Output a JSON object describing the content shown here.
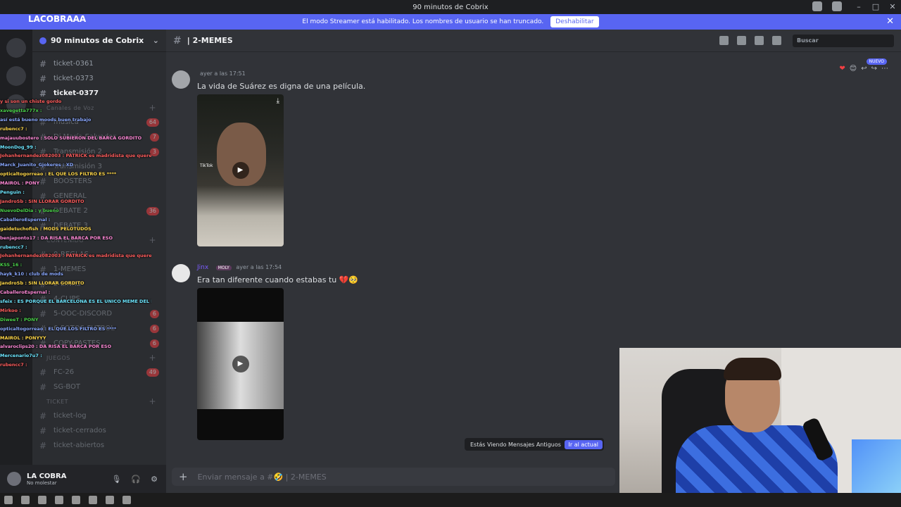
{
  "window": {
    "title": "90 minutos de Cobrix"
  },
  "banner": {
    "text": "El modo Streamer está habilitado. Los nombres de usuario se han truncado.",
    "button": "Deshabilitar"
  },
  "streamer_tag": "LACOBRAAA",
  "guild": {
    "name": "90 minutos de Cobrix"
  },
  "channels": [
    {
      "name": "ticket-0361",
      "bold": false
    },
    {
      "name": "ticket-0373",
      "bold": false
    },
    {
      "name": "ticket-0377",
      "bold": true
    }
  ],
  "sidebar_extra": [
    {
      "type": "cat",
      "label": "Canales de Voz"
    },
    {
      "type": "ch",
      "label": "musica",
      "badge": "64"
    },
    {
      "type": "ch",
      "label": "Di María Salvador",
      "badge": "7"
    },
    {
      "type": "ch",
      "label": "Transmisión 2",
      "badge": "3"
    },
    {
      "type": "ch",
      "label": "Transmisión 3",
      "badge": ""
    },
    {
      "type": "ch",
      "label": "BOOSTERS",
      "badge": ""
    },
    {
      "type": "ch",
      "label": "GENERAL",
      "badge": ""
    },
    {
      "type": "ch",
      "label": "DEBATE 2",
      "badge": "36"
    },
    {
      "type": "ch",
      "label": "DEBATE 3",
      "badge": ""
    },
    {
      "type": "cat",
      "label": "CONTENIDO"
    },
    {
      "type": "ch",
      "label": "0-REGLAS",
      "badge": ""
    },
    {
      "type": "ch",
      "label": "1-MEMES",
      "badge": ""
    },
    {
      "type": "ch",
      "label": "2-LINKS",
      "badge": ""
    },
    {
      "type": "ch",
      "label": "4-CLIPS",
      "badge": ""
    },
    {
      "type": "ch",
      "label": "5-OOC-DISCORD",
      "badge": "6"
    },
    {
      "type": "ch",
      "label": "6-FOTOS-FUTBOL",
      "badge": "6"
    },
    {
      "type": "ch",
      "label": "COPY-PASTES",
      "badge": "6"
    },
    {
      "type": "cat",
      "label": "JUEGOS"
    },
    {
      "type": "ch",
      "label": "FC-26",
      "badge": "49"
    },
    {
      "type": "ch",
      "label": "SG-BOT",
      "badge": ""
    },
    {
      "type": "cat",
      "label": "TICKET"
    },
    {
      "type": "ch",
      "label": "ticket-log",
      "badge": ""
    },
    {
      "type": "ch",
      "label": "ticket-cerrados",
      "badge": ""
    },
    {
      "type": "ch",
      "label": "ticket-abiertos",
      "badge": ""
    }
  ],
  "chat_overlay": [
    "y si son un chiste gordo",
    "xavegetta777x : ",
    "así está bueno moods buen trabajo",
    "rubencc7 : ",
    "majauubostero : SOLO SUBIERON DEL BARCA GORDITO",
    "MoonDog_99 : ",
    "Johanhernandez082003 : PATRICK es madridista que queres",
    "",
    "Marck_Juanito_Gjokeres : XD",
    "opticaltogorreao : EL QUE LOS FILTRO ES ****",
    "MAIROL : PONY",
    "Penguin : ",
    "JandroSb : SIN LLORAR GORDITO",
    "NuevoDelDia : y bueno",
    "CaballeroEspernal : ",
    "gaidetuchofish : MODS PELOTUDOS",
    "benjaponto17 : DA RISA EL BARCA POR ESO",
    "rubencc7 : ",
    "Johanhernandez082003 : PATRICK es madridista que queres",
    "KSS_16 : ",
    "hayk_k10 : club de mods",
    "JandroSb : SIN LLORAR GORDITO",
    "CaballeroEspernal : ",
    "sfeix : ES PORQUE EL BARCELONA ES EL UNICO MEME DEL DIA",
    "Mirkoo : ",
    "DiweeT : PONY",
    "opticaltogorreao : EL QUE LOS FILTRO ES ****",
    "MAIROL : PONYYY",
    "alvaroclips20 : DA RISA EL BARCA POR ESO",
    "Mercenario7u7 : ",
    "rubencc7 : "
  ],
  "user": {
    "name": "LA COBRA",
    "status": "No molestar"
  },
  "channel_header": {
    "name": "| 2-MEMES",
    "search_placeholder": "Buscar"
  },
  "messages": [
    {
      "time": "ayer a las 17:51",
      "text": "La vida de Suárez es digna de una película.",
      "username": "",
      "video_label": "TikTok"
    },
    {
      "time": "ayer a las 17:54",
      "text": "Era tan diferente cuando estabas tu 💔🥺",
      "username": "Jinx",
      "role": "MOLY",
      "video_label": ""
    }
  ],
  "new_badge": "NUEVO",
  "old_messages": {
    "text": "Estás Viendo Mensajes Antiguos",
    "jump": "Ir al actual"
  },
  "composer": {
    "placeholder": "Enviar mensaje a #🤣 | 2-MEMES"
  }
}
